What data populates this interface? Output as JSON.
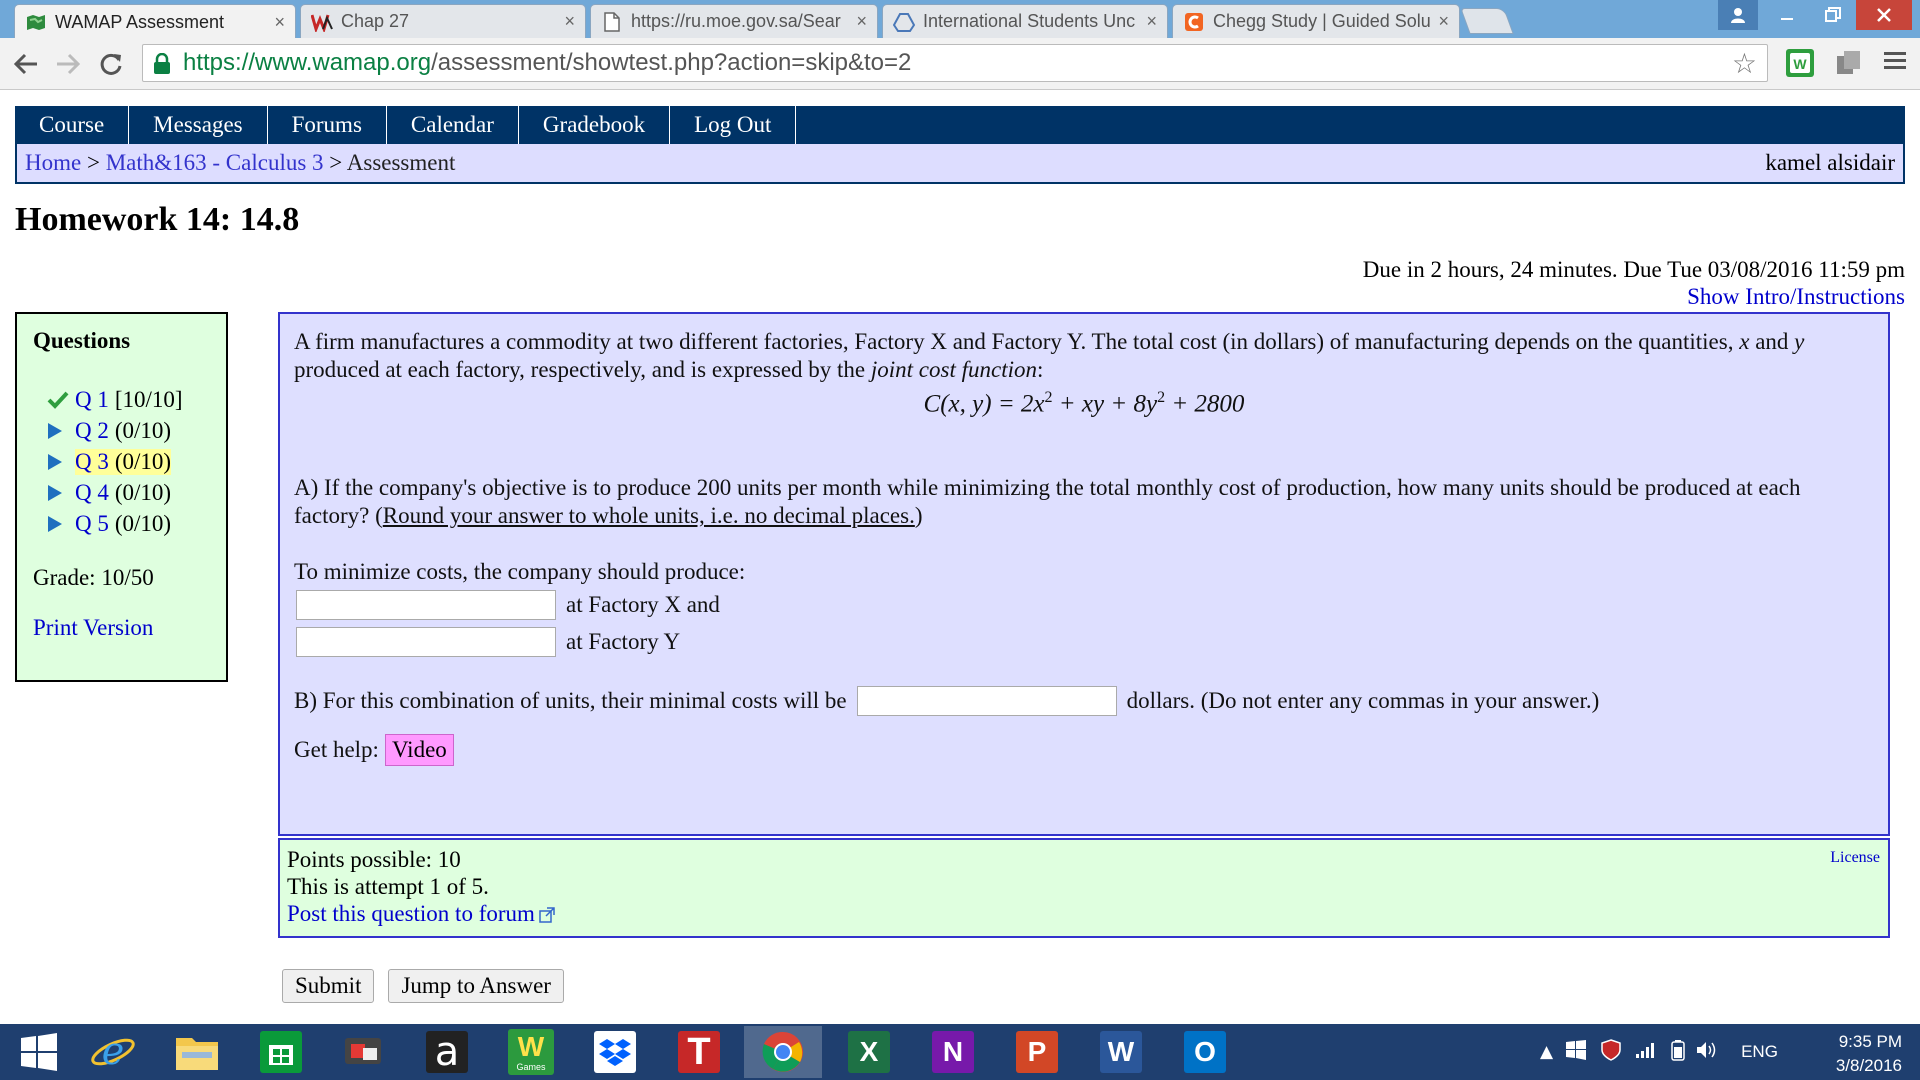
{
  "browser": {
    "tabs": [
      {
        "title": "WAMAP Assessment",
        "icon": "map-icon",
        "active": true
      },
      {
        "title": "Chap 27",
        "icon": "wa-logo-icon",
        "active": false
      },
      {
        "title": "https://ru.moe.gov.sa/Sear",
        "icon": "page-icon",
        "active": false
      },
      {
        "title": "International Students Unc",
        "icon": "drive-icon",
        "active": false
      },
      {
        "title": "Chegg Study | Guided Solu",
        "icon": "chegg-icon",
        "active": false
      }
    ],
    "close_glyph": "×",
    "url_secure": "https://www.wamap.org",
    "url_path": "/assessment/showtest.php?action=skip&to=2"
  },
  "nav": {
    "items": [
      "Course",
      "Messages",
      "Forums",
      "Calendar",
      "Gradebook",
      "Log Out"
    ]
  },
  "breadcrumb": {
    "home": "Home",
    "sep": ">",
    "course": "Math&163 - Calculus 3",
    "current": "Assessment",
    "user": "kamel alsidair"
  },
  "page": {
    "title": "Homework 14: 14.8",
    "due": "Due in 2 hours, 24 minutes. Due Tue 03/08/2016 11:59 pm",
    "intro_link": "Show Intro/Instructions"
  },
  "questions_panel": {
    "heading": "Questions",
    "items": [
      {
        "label": "Q 1",
        "score": "[10/10]",
        "status": "done"
      },
      {
        "label": "Q 2",
        "score": "(0/10)",
        "status": "pending"
      },
      {
        "label": "Q 3",
        "score": "(0/10)",
        "status": "current"
      },
      {
        "label": "Q 4",
        "score": "(0/10)",
        "status": "pending"
      },
      {
        "label": "Q 5",
        "score": "(0/10)",
        "status": "pending"
      }
    ],
    "grade": "Grade: 10/50",
    "print_link": "Print Version"
  },
  "question": {
    "intro_a": "A firm manufactures a commodity at two different factories, Factory X and Factory Y. The total cost (in dollars) of manufacturing depends on the quantities, ",
    "var_x": "x",
    "intro_b": " and ",
    "var_y": "y",
    "intro_c": " produced at each factory, respectively, and is expressed by the ",
    "intro_em": "joint cost function",
    "intro_d": ":",
    "formula": {
      "lhs": "C(x, y) = 2x",
      "exp1": "2",
      "mid": " + xy + 8y",
      "exp2": "2",
      "rhs": " + 2800"
    },
    "partA_a": "A) If the company's objective is to produce 200 units per month while minimizing the total monthly cost of production, how many units should be produced at each factory? (",
    "partA_underline": "Round your answer to whole units, i.e. no decimal places.",
    "partA_b": ")",
    "minimize_text": "To minimize costs, the company should produce:",
    "answer_x_label": "at Factory X and",
    "answer_y_label": "at Factory Y",
    "answer_x_value": "",
    "answer_y_value": "",
    "partB_a": "B) For this combination of units, their minimal costs will be",
    "partB_b": "dollars. (Do not enter any commas in your answer.)",
    "partB_value": "",
    "help_label": "Get help:",
    "video_button": "Video"
  },
  "info": {
    "points": "Points possible: 10",
    "attempt": "This is attempt 1 of 5.",
    "forum_link": "Post this question to forum",
    "license": "License"
  },
  "buttons": {
    "submit": "Submit",
    "jump": "Jump to Answer"
  },
  "taskbar": {
    "apps": [
      "windows-start",
      "internet-explorer",
      "file-explorer",
      "windows-store",
      "screen-recorder",
      "amazon",
      "wamap-games",
      "dropbox",
      "t-app",
      "chrome",
      "excel",
      "onenote",
      "powerpoint",
      "word",
      "outlook"
    ],
    "amazon_letter": "a",
    "games_label": "Games",
    "t_letter": "T",
    "excel_letter": "X",
    "onenote_letter": "N",
    "powerpoint_letter": "P",
    "word_letter": "W",
    "outlook_letter": "O",
    "lang": "ENG",
    "time": "9:35 PM",
    "date": "3/8/2016"
  },
  "colors": {
    "nav_bg": "#003366",
    "breadcrumb_bg": "#ddddff",
    "question_bg": "#dedfff",
    "panel_green": "#dfffdf",
    "link_blue": "#0000cc",
    "video_pink": "#ff99ff",
    "current_highlight": "#ffff99",
    "check_green": "#2e9e3e",
    "arrow_blue": "#1f6fbf"
  }
}
